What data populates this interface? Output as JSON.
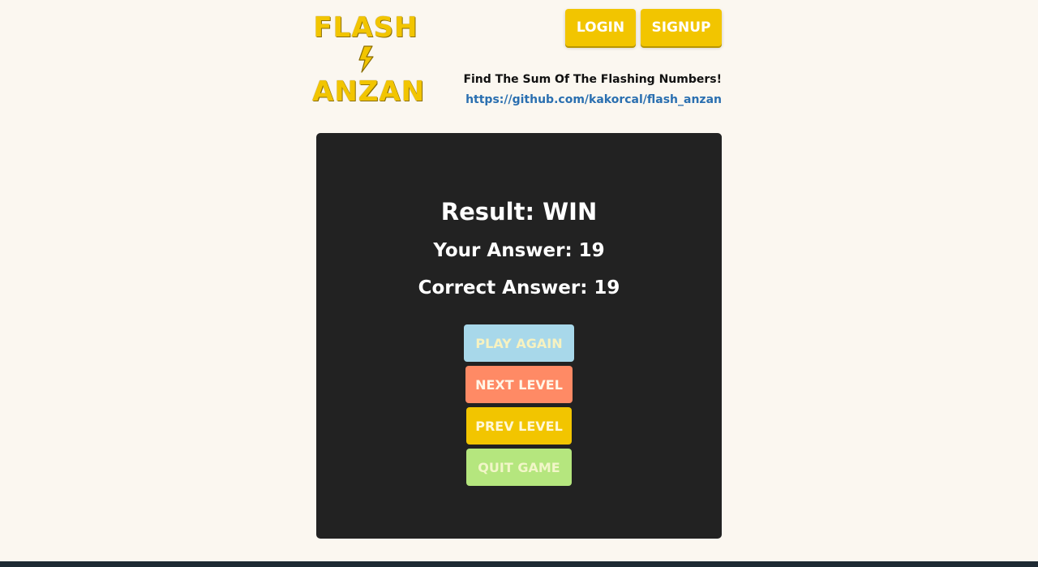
{
  "header": {
    "logo": {
      "line1": "FLASH",
      "icon": "lightning-bolt-icon",
      "line2": "ANZAN"
    },
    "login_label": "LOGIN",
    "signup_label": "SIGNUP",
    "tagline": "Find The Sum Of The Flashing Numbers!",
    "repo_link": "https://github.com/kakorcal/flash_anzan"
  },
  "result": {
    "title": "Result: WIN",
    "your_answer": "Your Answer: 19",
    "correct_answer": "Correct Answer: 19"
  },
  "actions": {
    "play_again": "PLAY AGAIN",
    "next_level": "NEXT LEVEL",
    "prev_level": "PREV LEVEL",
    "quit_game": "QUIT GAME"
  },
  "colors": {
    "page_bg": "#fbf7f0",
    "brand_yellow": "#f2c500",
    "panel_bg": "#222222",
    "link_blue": "#2a6fb0",
    "play_again_bg": "#a8d8ea",
    "next_level_bg": "#ff8a65",
    "prev_level_bg": "#f2c500",
    "quit_game_bg": "#b5e67e"
  }
}
